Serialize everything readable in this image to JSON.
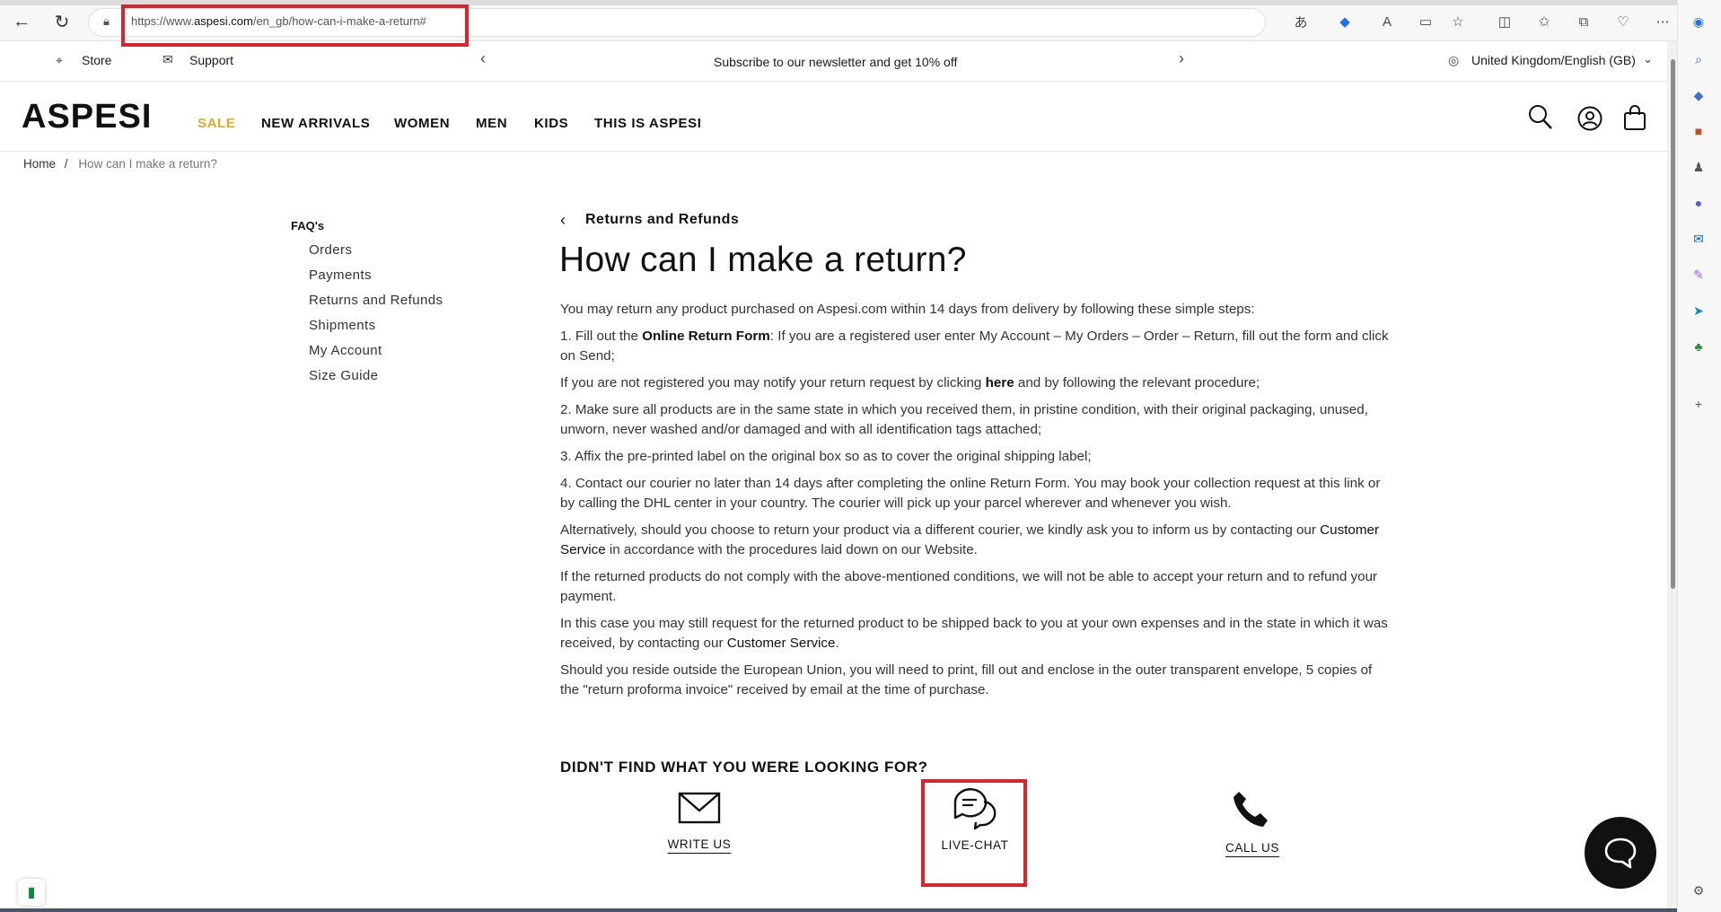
{
  "browser": {
    "url_prefix": "https://www.",
    "url_domain": "aspesi.com",
    "url_path": "/en_gb/how-can-i-make-a-return#"
  },
  "utility": {
    "store": "Store",
    "support": "Support",
    "promo": "Subscribe to our newsletter and get 10% off",
    "locale": "United Kingdom/English (GB)"
  },
  "header": {
    "logo": "ASPESI",
    "menu": [
      "SALE",
      "NEW ARRIVALS",
      "WOMEN",
      "MEN",
      "KIDS",
      "THIS IS ASPESI"
    ]
  },
  "breadcrumb": {
    "home": "Home",
    "separator": "/",
    "current": "How can I make a return?"
  },
  "faq": {
    "title": "FAQ's",
    "links": [
      "Orders",
      "Payments",
      "Returns and Refunds",
      "Shipments",
      "My Account",
      "Size Guide"
    ]
  },
  "main": {
    "back_label": "Returns and Refunds",
    "title": "How can I make a return?",
    "intro": "You may return any product purchased on Aspesi.com within 14 days from delivery by following these simple steps:",
    "step1_pre": "1. Fill out the ",
    "step1_link": "Online Return Form",
    "step1_post": ": If you are a registered user enter My Account – My Orders – Order – Return, fill out the form and click on Send;",
    "notreg_pre": "If you are not registered you may notify your return request by clicking ",
    "notreg_link": "here",
    "notreg_post": " and by following the relevant procedure;",
    "step2": "2. Make sure all products are in the same state in which you received them, in pristine condition, with their original packaging, unused, unworn, never washed and/or damaged and with all identification tags attached;",
    "step3": "3. Affix the pre-printed label on the original box so as to cover the original shipping label;",
    "step4": "4. Contact our courier no later than 14 days after completing the online Return Form. You may book your collection request at this link or by calling the DHL center in your country. The courier will pick up your parcel wherever and whenever you wish.",
    "alt_pre": "Alternatively, should you choose to return your product via a different courier, we kindly ask you to inform us by contacting our ",
    "alt_link": "Customer Service",
    "alt_post": " in accordance with the procedures laid down on our Website.",
    "noncomply": "If the returned products do not comply with the above-mentioned conditions, we will not be able to accept your return and to refund your payment.",
    "shipback_pre": "In this case you may still request for the returned product to be shipped back to you at your own expenses and in the state in which it was received, by contacting our ",
    "shipback_link": "Customer Service",
    "shipback_post": ".",
    "outside_eu": "Should you reside outside the European Union, you will need to print, fill out and enclose in the outer transparent envelope, 5 copies of the \"return proforma invoice\" received by email at the time of purchase."
  },
  "help": {
    "title": "DIDN'T FIND WHAT YOU WERE LOOKING FOR?",
    "write_us": "WRITE US",
    "live_chat": "LIVE-CHAT",
    "call_us": "CALL US"
  },
  "colors": {
    "accent_sale": "#e3a92a",
    "highlight_red": "#d9262e"
  }
}
